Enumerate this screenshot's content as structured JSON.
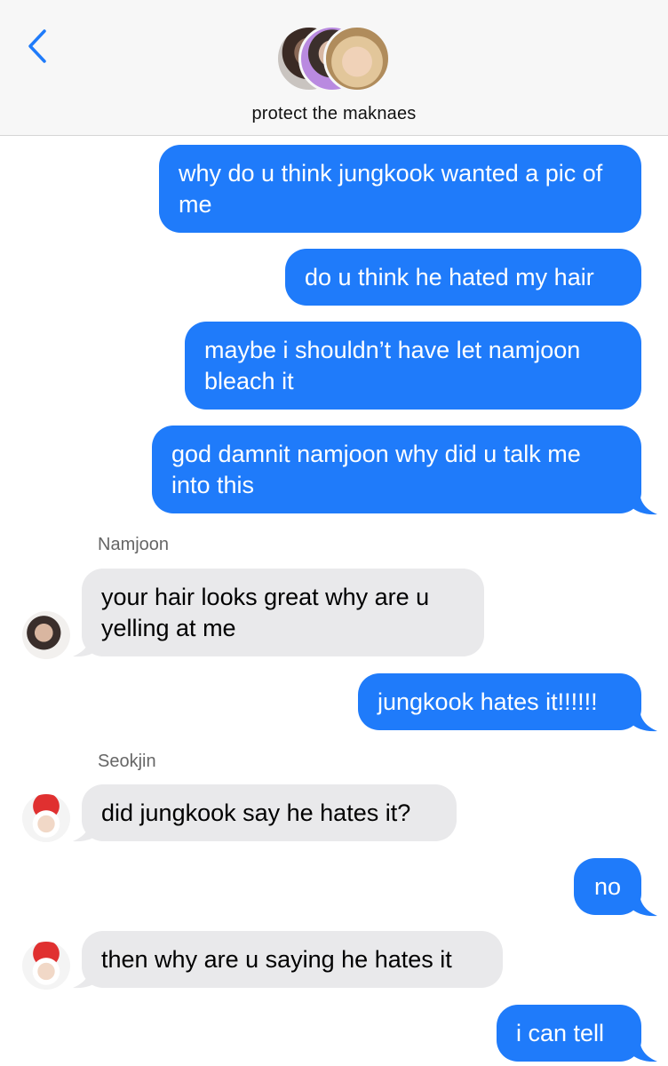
{
  "header": {
    "title": "protect the maknaes",
    "back_icon": "chevron-left-icon",
    "accent_color": "#1f7bfa"
  },
  "messages": [
    {
      "direction": "sent",
      "text": "why do u think jungkook wanted a pic of me"
    },
    {
      "direction": "sent",
      "text": "do u think he hated my hair"
    },
    {
      "direction": "sent",
      "text": "maybe i shouldn’t have let namjoon bleach it"
    },
    {
      "direction": "sent",
      "text": "god damnit namjoon why did u talk me into this"
    },
    {
      "direction": "received",
      "sender": "Namjoon",
      "text": "your hair looks great why are u yelling at me"
    },
    {
      "direction": "sent",
      "text": "jungkook hates it!!!!!!"
    },
    {
      "direction": "received",
      "sender": "Seokjin",
      "text": "did jungkook say he hates it?"
    },
    {
      "direction": "sent",
      "text": "no"
    },
    {
      "direction": "received",
      "text": "then why are u saying he hates it"
    },
    {
      "direction": "sent",
      "text": "i can tell"
    }
  ],
  "colors": {
    "sent_bubble": "#1f7bfa",
    "received_bubble": "#e9e9eb",
    "header_background": "#f7f7f7"
  }
}
